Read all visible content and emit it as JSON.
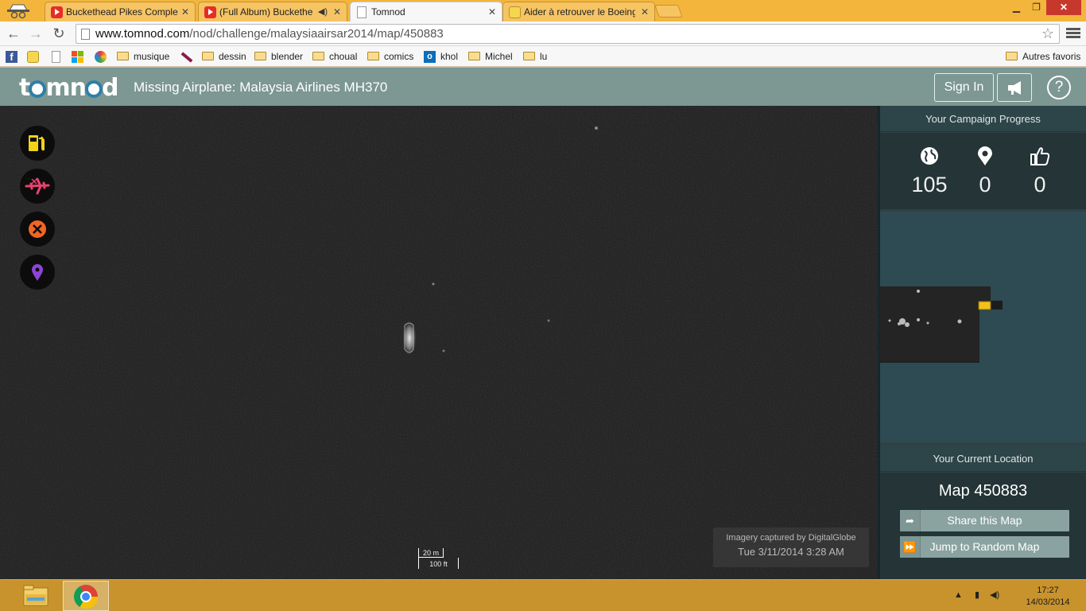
{
  "browser": {
    "tabs": [
      {
        "label": "Buckethead Pikes Comple",
        "favicon": "youtube-icon"
      },
      {
        "label": "(Full Album) Buckethe",
        "favicon": "youtube-icon",
        "has_audio": true
      },
      {
        "label": "Tomnod",
        "favicon": "page-icon",
        "active": true
      },
      {
        "label": "Aider à retrouver le Boeing",
        "favicon": "face-icon"
      }
    ],
    "close_glyph": "✕",
    "address": {
      "prefix": "www.tomnod.com",
      "path": "/nod/challenge/malaysiaairsar2014/map/450883"
    },
    "bookmarks": [
      "musique",
      "dessin",
      "blender",
      "choual",
      "comics",
      "khol",
      "Michel",
      "lu"
    ],
    "other_bookmarks": "Autres favoris"
  },
  "header": {
    "logo_text": [
      "t",
      "mn",
      "d"
    ],
    "title": "Missing Airplane: Malaysia Airlines MH370",
    "signin_label": "Sign In",
    "help_label": "?"
  },
  "map": {
    "tools": [
      {
        "name": "fuel-icon",
        "color": "#f2d21b"
      },
      {
        "name": "wreckage-icon",
        "color": "#e8426f"
      },
      {
        "name": "close-circle-icon",
        "color": "#f26522"
      },
      {
        "name": "pin-icon",
        "color": "#8b44d6"
      }
    ],
    "scale_metric": "20 m",
    "scale_imperial": "100 ft",
    "imagery_credit": "Imagery captured by DigitalGlobe",
    "imagery_date": "Tue 3/11/2014 3:28 AM"
  },
  "panel": {
    "progress_title": "Your Campaign Progress",
    "stats": [
      {
        "icon": "globe-icon",
        "value": "105"
      },
      {
        "icon": "pin-icon",
        "value": "0"
      },
      {
        "icon": "thumbs-up-icon",
        "value": "0"
      }
    ],
    "location_title": "Your Current Location",
    "location_name": "Map 450883",
    "share_label": "Share this Map",
    "jump_label": "Jump to Random Map"
  },
  "taskbar": {
    "time": "17:27",
    "date": "14/03/2014"
  }
}
